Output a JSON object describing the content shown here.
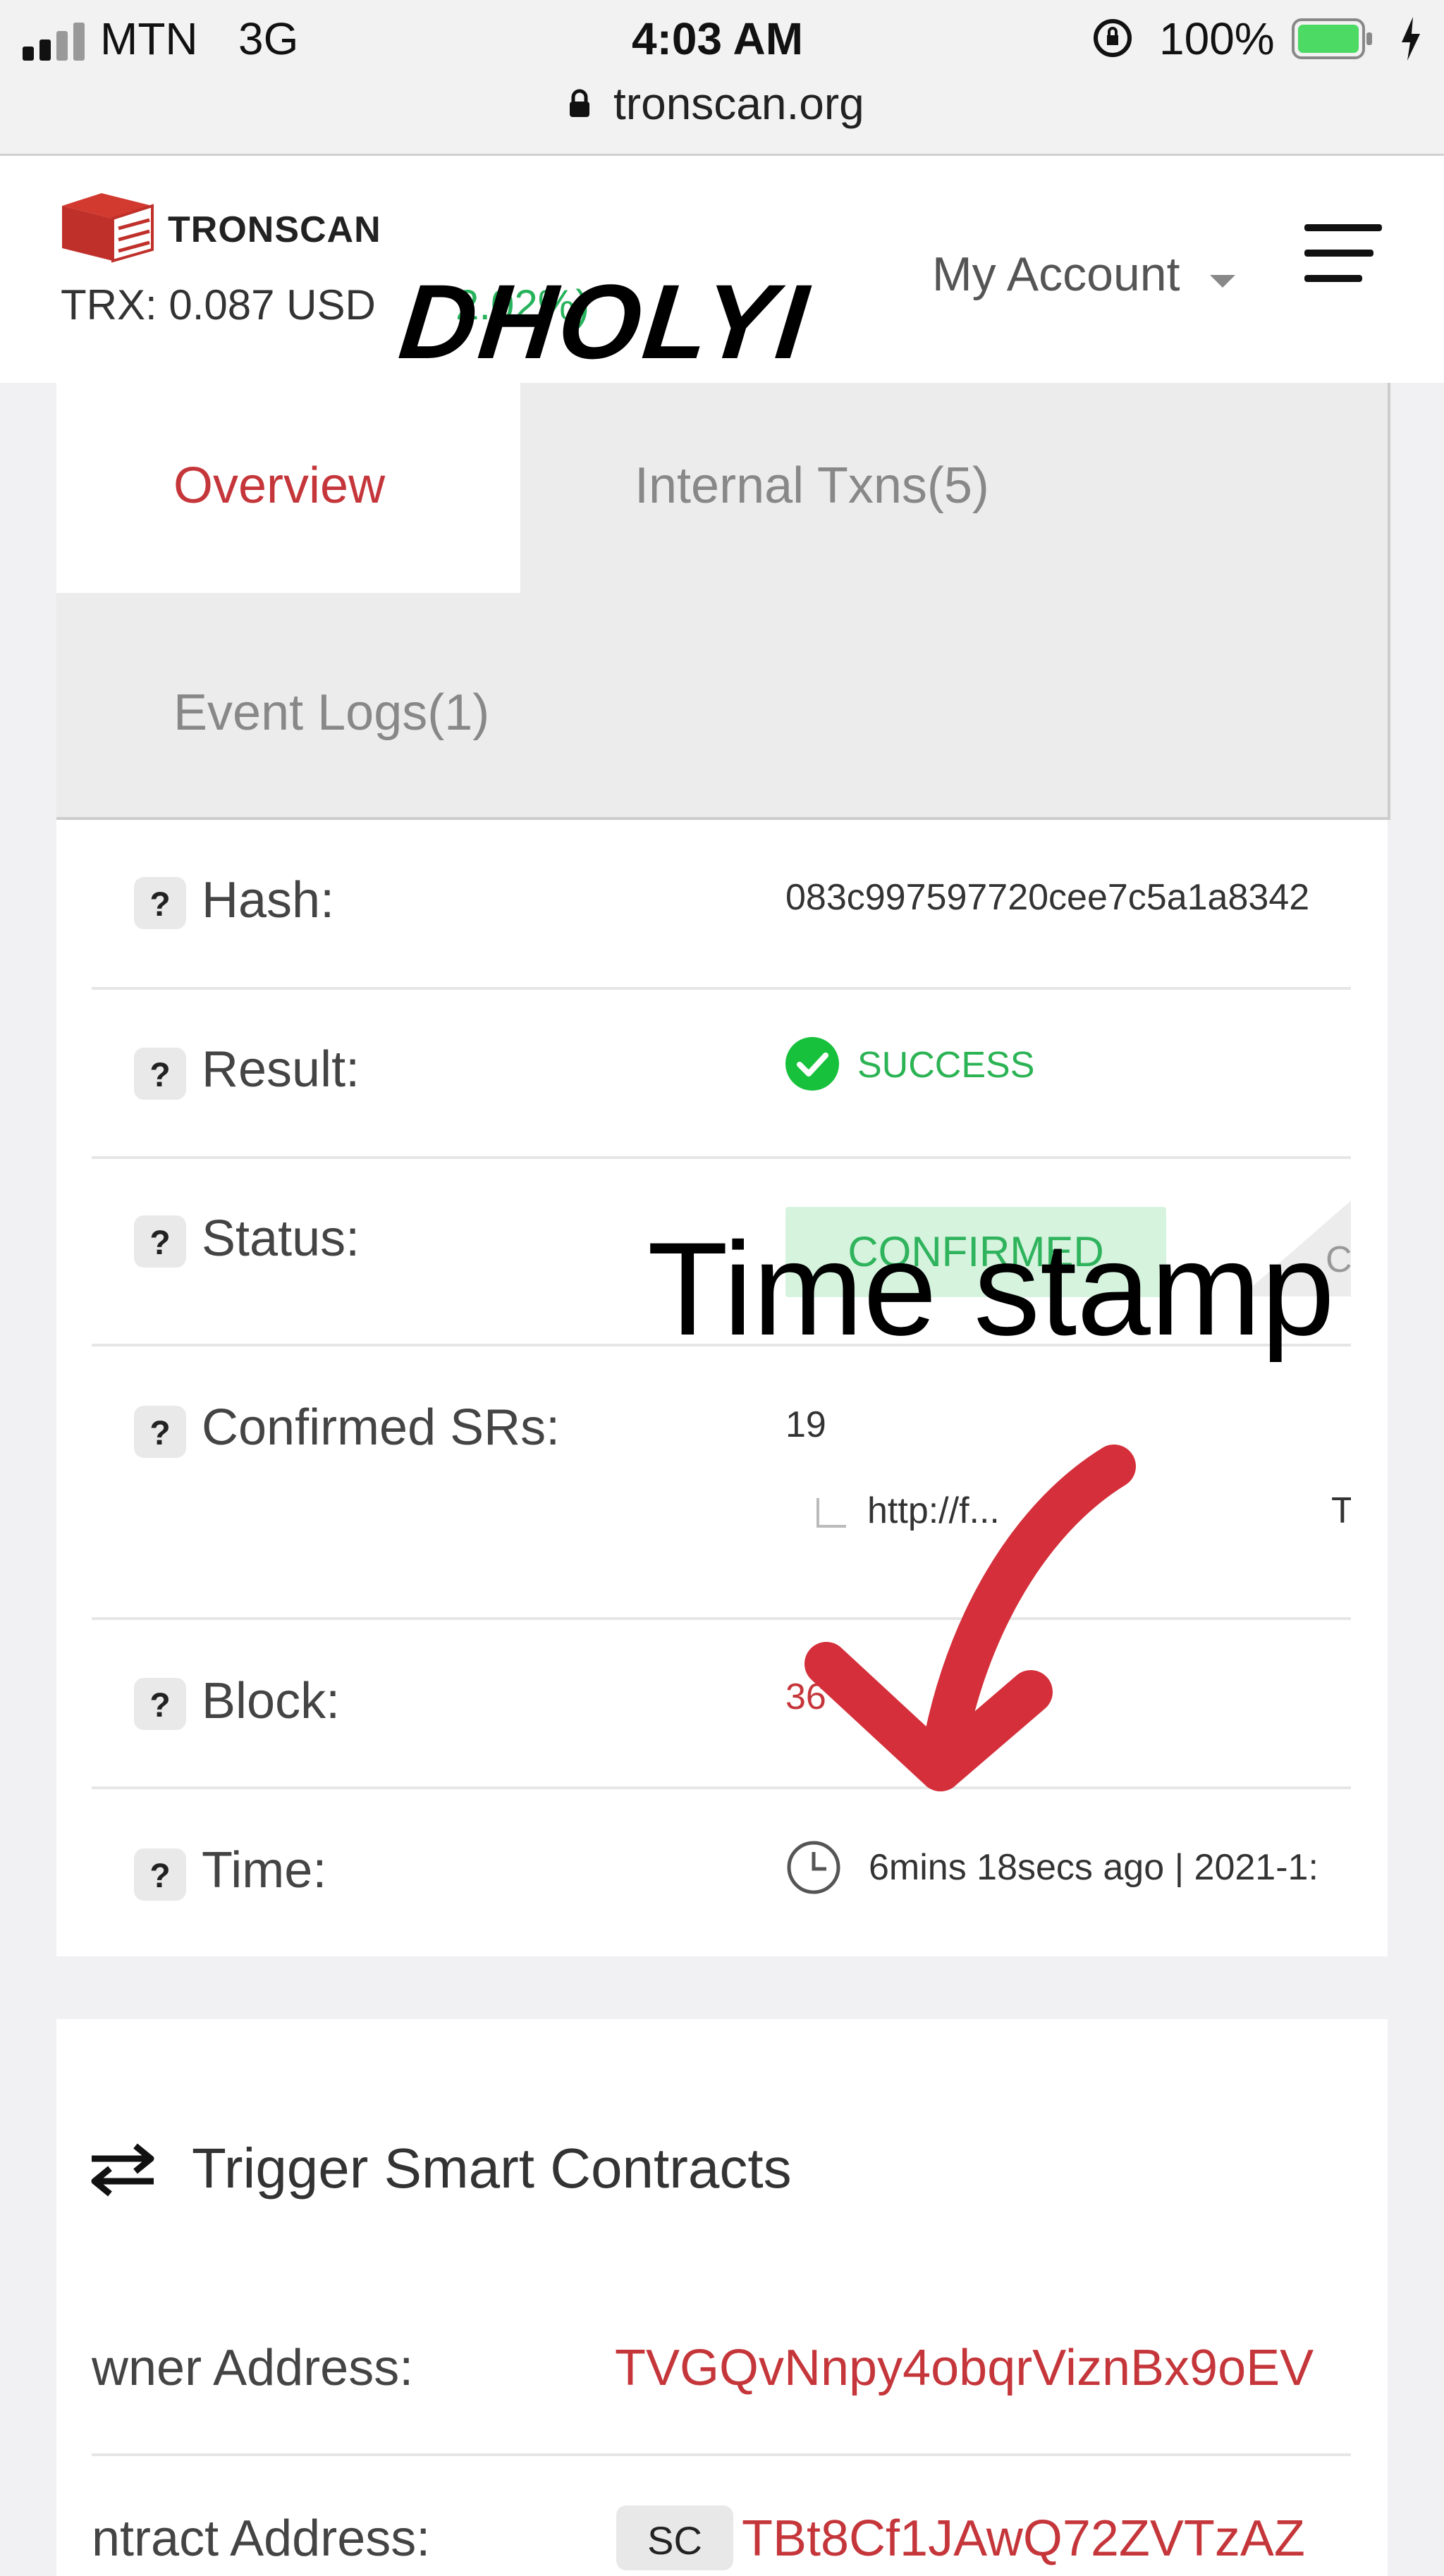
{
  "status_bar": {
    "carrier": "MTN",
    "network": "3G",
    "time": "4:03 AM",
    "battery": "100%",
    "url": "tronscan.org"
  },
  "header": {
    "brand": "TRONSCAN",
    "price": "TRX: 0.087 USD",
    "change": "2.02%)",
    "watermark": "DHOLYI",
    "account": "My Account"
  },
  "tabs": [
    {
      "label": "Overview"
    },
    {
      "label": "Internal Txns(5)"
    },
    {
      "label": "Event Logs(1)"
    }
  ],
  "details": {
    "hash_label": "Hash:",
    "hash_value": "083c997597720cee7c5a1a8342",
    "result_label": "Result:",
    "result_value": "SUCCESS",
    "status_label": "Status:",
    "status_value": "CONFIRMED",
    "status_extra": "C",
    "confirmed_srs_label": "Confirmed SRs:",
    "confirmed_srs_value": "19",
    "sr_link": "http://f...",
    "sr_extra": "T",
    "block_label": "Block:",
    "block_value": "36",
    "time_label": "Time:",
    "time_value": "6mins 18secs ago | 2021-1:"
  },
  "annotation": "Time stamp",
  "contracts": {
    "title": "Trigger Smart Contracts",
    "owner_label": "wner Address:",
    "owner_value": "TVGQvNnpy4obqrViznBx9oEV",
    "contract_label": "ntract Address:",
    "contract_badge": "SC",
    "contract_value": "TBt8Cf1JAwQ72ZVTzAZ"
  },
  "colors": {
    "accent_red": "#c5363b",
    "success_green": "#27b35c",
    "badge_bg": "#d6f3de"
  }
}
